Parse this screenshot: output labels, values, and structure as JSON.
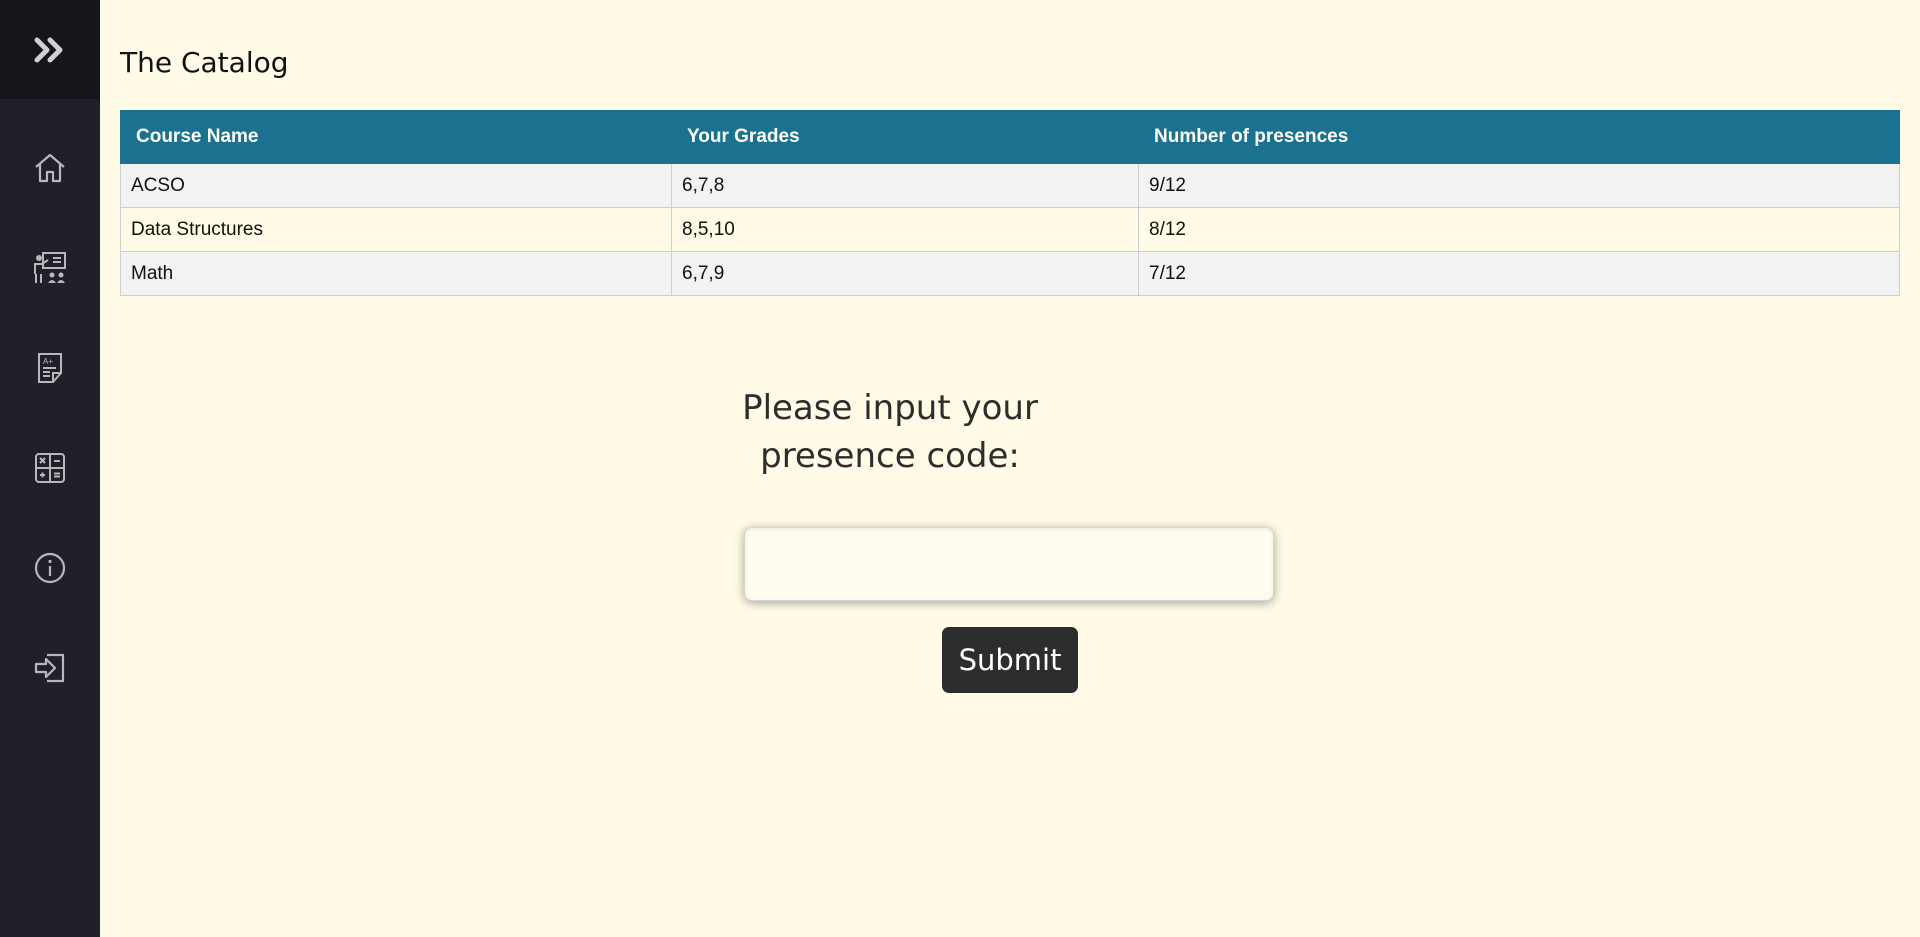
{
  "sidebar": {
    "toggle_icon": "double-chevron-right-icon",
    "items": [
      {
        "name": "home",
        "icon": "home-icon"
      },
      {
        "name": "teacher",
        "icon": "teacher-board-icon"
      },
      {
        "name": "grades",
        "icon": "grade-document-icon"
      },
      {
        "name": "calculator",
        "icon": "calculator-icon"
      },
      {
        "name": "info",
        "icon": "info-icon"
      },
      {
        "name": "login",
        "icon": "login-icon"
      }
    ],
    "colors": {
      "background": "#1f2029",
      "top": "#15161c",
      "icon": "#b8b8b8"
    }
  },
  "page": {
    "title": "The Catalog"
  },
  "catalog": {
    "headers": [
      "Course Name",
      "Your Grades",
      "Number of presences"
    ],
    "rows": [
      [
        "ACSO",
        "6,7,8",
        "9/12"
      ],
      [
        "Data Structures",
        "8,5,10",
        "8/12"
      ],
      [
        "Math",
        "6,7,9",
        "7/12"
      ]
    ],
    "colors": {
      "header": "#1b7290",
      "row_odd": "#f2f2f2",
      "row_even": "#fffbe6"
    }
  },
  "presence": {
    "prompt": "Please input your presence code:",
    "input_value": "",
    "input_placeholder": "",
    "submit_label": "Submit"
  }
}
